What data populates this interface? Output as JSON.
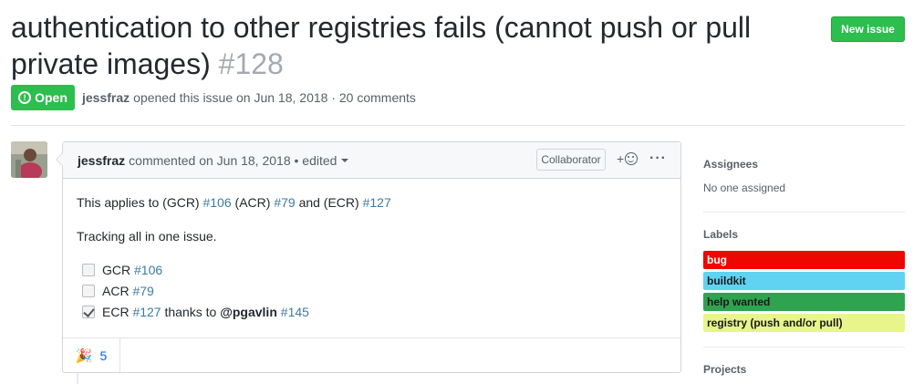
{
  "issue": {
    "title": "authentication to other registries fails (cannot push or pull private images)",
    "number": "#128",
    "state": "Open",
    "state_icon": "!",
    "author": "jessfraz",
    "opened_text": "opened this issue on Jun 18, 2018 · 20 comments"
  },
  "header": {
    "new_issue_label": "New issue"
  },
  "comment": {
    "author": "jessfraz",
    "meta": "commented on Jun 18, 2018 • edited",
    "role_label": "Collaborator",
    "add_reaction_plus": "+",
    "more": "···",
    "body": {
      "line1_prefix": "This applies to (GCR)",
      "line1_ref1": "#106",
      "line1_mid1": "(ACR)",
      "line1_ref2": "#79",
      "line1_mid2": "and (ECR)",
      "line1_ref3": "#127",
      "line2": "Tracking all in one issue."
    },
    "tasks": [
      {
        "text": "GCR",
        "ref": "#106",
        "checked": false
      },
      {
        "text": "ACR",
        "ref": "#79",
        "checked": false
      },
      {
        "text": "ECR",
        "ref": "#127",
        "suffix": "thanks to",
        "mention": "@pgavlin",
        "ref2": "#145",
        "checked": true
      }
    ],
    "reactions": [
      {
        "emoji": "🎉",
        "count": "5"
      }
    ]
  },
  "sidebar": {
    "assignees_heading": "Assignees",
    "assignees_value": "No one assigned",
    "labels_heading": "Labels",
    "labels": [
      {
        "name": "bug",
        "bg": "#ee0701",
        "fg": "#ffffff"
      },
      {
        "name": "buildkit",
        "bg": "#5fd3f1",
        "fg": "#1a1a1a"
      },
      {
        "name": "help wanted",
        "bg": "#2ea44f",
        "fg": "#1a1a1a"
      },
      {
        "name": "registry (push and/or pull)",
        "bg": "#e7f58a",
        "fg": "#1a1a1a"
      }
    ],
    "projects_heading": "Projects"
  },
  "colors": {
    "accent_green": "#2cbe4e",
    "link": "#0366d6"
  }
}
